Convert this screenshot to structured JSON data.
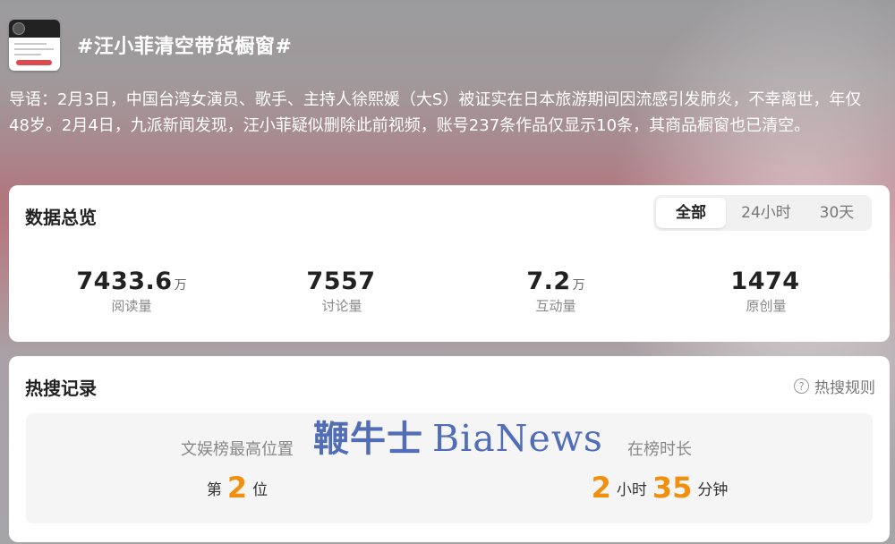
{
  "topic": {
    "title": "#汪小菲清空带货橱窗#",
    "intro": "导语：2月3日，中国台湾女演员、歌手、主持人徐熙媛（大S）被证实在日本旅游期间因流感引发肺炎，不幸离世，年仅48岁。2月4日，九派新闻发现，汪小菲疑似删除此前视频，账号237条作品仅显示10条，其商品橱窗也已清空。"
  },
  "overview": {
    "title": "数据总览",
    "tabs": [
      {
        "label": "全部",
        "active": true
      },
      {
        "label": "24小时",
        "active": false
      },
      {
        "label": "30天",
        "active": false
      }
    ],
    "stats": [
      {
        "value": "7433.6",
        "unit": "万",
        "label": "阅读量"
      },
      {
        "value": "7557",
        "unit": "",
        "label": "讨论量"
      },
      {
        "value": "7.2",
        "unit": "万",
        "label": "互动量"
      },
      {
        "value": "1474",
        "unit": "",
        "label": "原创量"
      }
    ]
  },
  "hot_search": {
    "title": "热搜记录",
    "rules_label": "热搜规则",
    "rules_icon": "question-icon",
    "rank_label": "文娱榜最高位置",
    "rank_prefix": "第",
    "rank_value": "2",
    "rank_suffix": "位",
    "duration_label": "在榜时长",
    "duration_hours": "2",
    "duration_hours_unit": "小时",
    "duration_minutes": "35",
    "duration_minutes_unit": "分钟",
    "accent_color": "#f0900e"
  },
  "watermark": {
    "cn": "鞭牛士",
    "en": "BiaNews"
  }
}
